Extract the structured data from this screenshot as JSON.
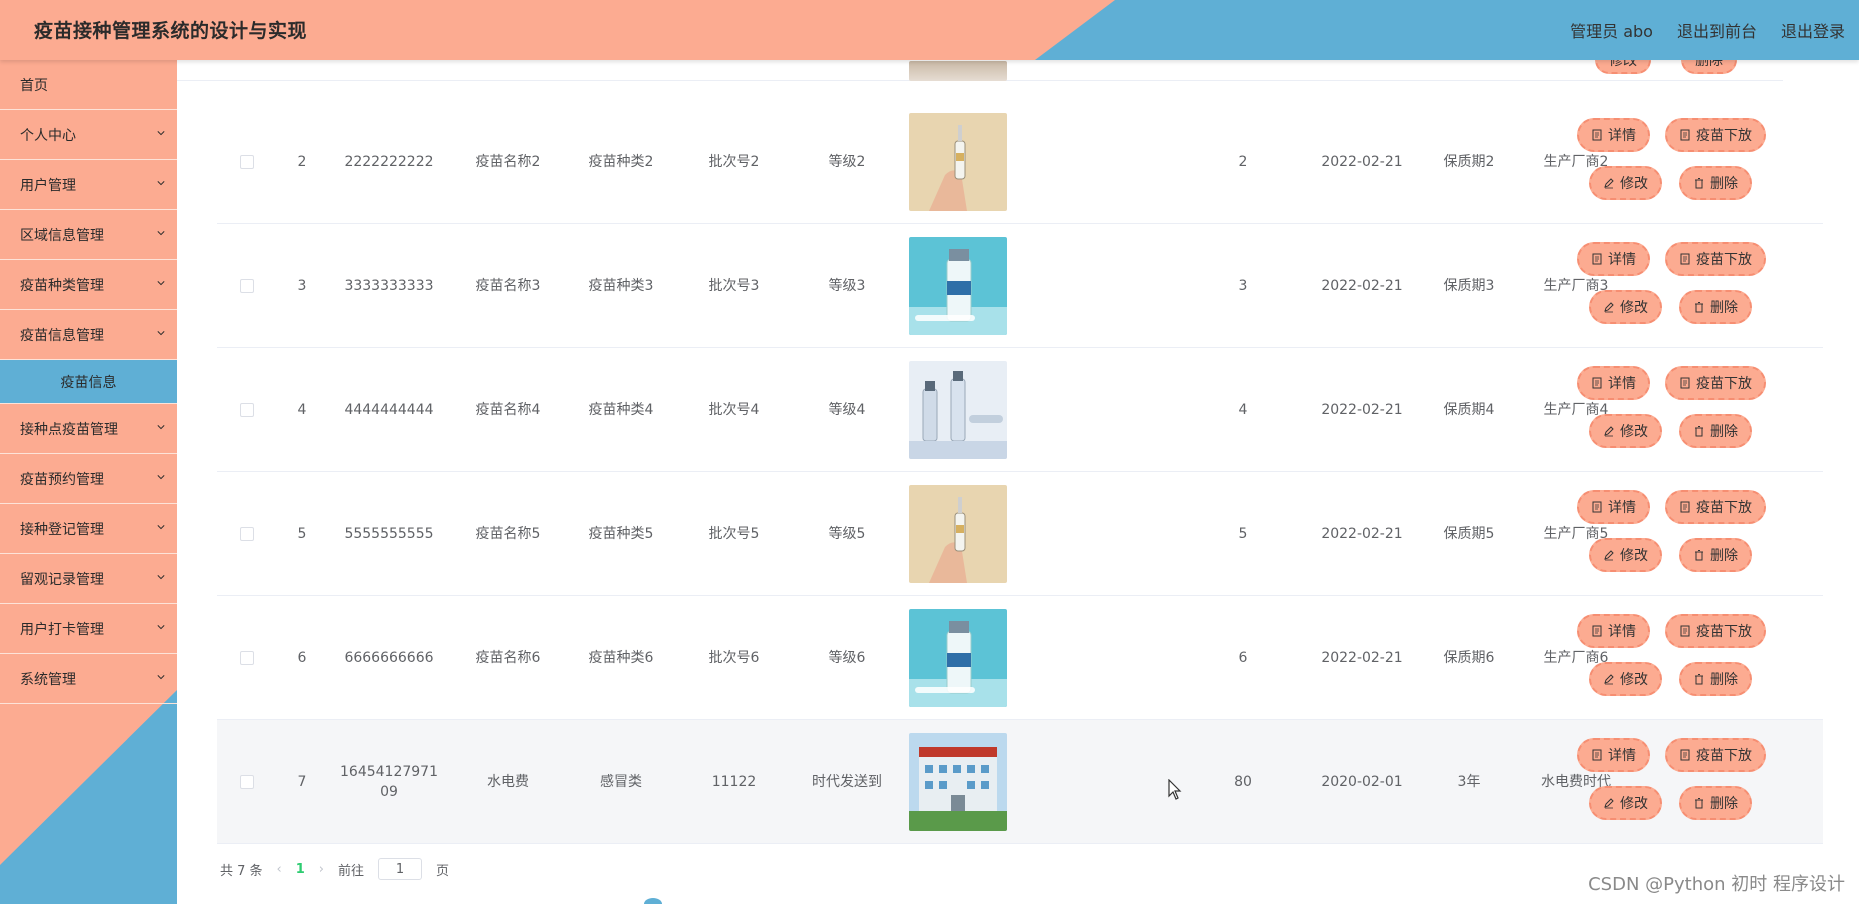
{
  "header": {
    "title": "疫苗接种管理系统的设计与实现",
    "user_label": "管理员 abo",
    "front_label": "退出到前台",
    "logout_label": "退出登录"
  },
  "sidebar": {
    "items": [
      {
        "label": "首页",
        "chevron": false
      },
      {
        "label": "个人中心",
        "chevron": true
      },
      {
        "label": "用户管理",
        "chevron": true
      },
      {
        "label": "区域信息管理",
        "chevron": true
      },
      {
        "label": "疫苗种类管理",
        "chevron": true
      },
      {
        "label": "疫苗信息管理",
        "chevron": true
      },
      {
        "label": "接种点疫苗管理",
        "chevron": true
      },
      {
        "label": "疫苗预约管理",
        "chevron": true
      },
      {
        "label": "接种登记管理",
        "chevron": true
      },
      {
        "label": "留观记录管理",
        "chevron": true
      },
      {
        "label": "用户打卡管理",
        "chevron": true
      },
      {
        "label": "系统管理",
        "chevron": true
      }
    ],
    "active_sub": "疫苗信息"
  },
  "buttons": {
    "detail": "详情",
    "off": "疫苗下放",
    "edit": "修改",
    "delete": "删除"
  },
  "rows": [
    {
      "index": "2",
      "code": "2222222222",
      "name": "疫苗名称2",
      "type": "疫苗种类2",
      "batch": "批次号2",
      "level": "等级2",
      "image": "syringe-hand",
      "qty": "2",
      "date": "2022-02-21",
      "shelf": "保质期2",
      "maker": "生产厂商2"
    },
    {
      "index": "3",
      "code": "3333333333",
      "name": "疫苗名称3",
      "type": "疫苗种类3",
      "batch": "批次号3",
      "level": "等级3",
      "image": "vial-blue",
      "qty": "3",
      "date": "2022-02-21",
      "shelf": "保质期3",
      "maker": "生产厂商3"
    },
    {
      "index": "4",
      "code": "4444444444",
      "name": "疫苗名称4",
      "type": "疫苗种类4",
      "batch": "批次号4",
      "level": "等级4",
      "image": "vials-white",
      "qty": "4",
      "date": "2022-02-21",
      "shelf": "保质期4",
      "maker": "生产厂商4"
    },
    {
      "index": "5",
      "code": "5555555555",
      "name": "疫苗名称5",
      "type": "疫苗种类5",
      "batch": "批次号5",
      "level": "等级5",
      "image": "syringe-hand",
      "qty": "5",
      "date": "2022-02-21",
      "shelf": "保质期5",
      "maker": "生产厂商5"
    },
    {
      "index": "6",
      "code": "6666666666",
      "name": "疫苗名称6",
      "type": "疫苗种类6",
      "batch": "批次号6",
      "level": "等级6",
      "image": "vial-blue",
      "qty": "6",
      "date": "2022-02-21",
      "shelf": "保质期6",
      "maker": "生产厂商6"
    },
    {
      "index": "7",
      "code": "1645412797109",
      "name": "水电费",
      "type": "感冒类",
      "batch": "11122",
      "level": "时代发送到",
      "image": "hospital",
      "qty": "80",
      "date": "2020-02-01",
      "shelf": "3年",
      "maker": "水电费时代"
    }
  ],
  "pagination": {
    "total": "共 7 条",
    "prev": "‹",
    "current": "1",
    "next": "›",
    "goto_label": "前往",
    "goto_value": "1",
    "page_suffix": "页"
  },
  "watermark": "CSDN @Python 初时 程序设计",
  "colors": {
    "peach": "#fcab91",
    "blue": "#5fafd5",
    "button_border": "#f68e72"
  }
}
